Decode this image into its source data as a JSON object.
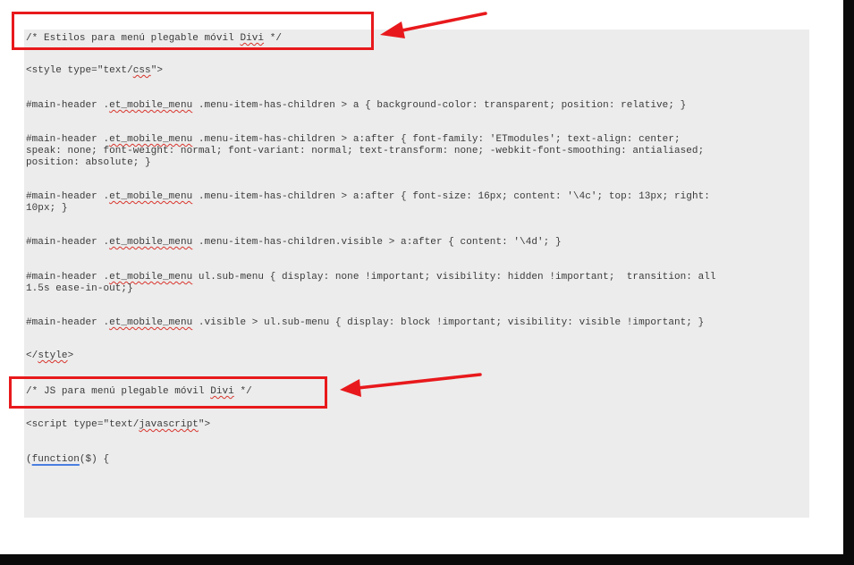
{
  "annotations": {
    "box_color": "#e8191c",
    "arrow_icon": "red-arrow-icon"
  },
  "code": {
    "comment_css": "/* Estilos para menú plegable móvil Divi */",
    "style_open": "<style type=\"text/css\">",
    "rule1": "#main-header .et_mobile_menu .menu-item-has-children > a { background-color: transparent; position: relative; }",
    "rule2_l1": "#main-header .et_mobile_menu .menu-item-has-children > a:after { font-family: 'ETmodules'; text-align: center;",
    "rule2_l2": "speak: none; font-weight: normal; font-variant: normal; text-transform: none; -webkit-font-smoothing: antialiased;",
    "rule2_l3": "position: absolute; }",
    "rule3_l1": "#main-header .et_mobile_menu .menu-item-has-children > a:after { font-size: 16px; content: '\\4c'; top: 13px; right:",
    "rule3_l2": "10px; }",
    "rule4": "#main-header .et_mobile_menu .menu-item-has-children.visible > a:after { content: '\\4d'; }",
    "rule5_l1": "#main-header .et_mobile_menu ul.sub-menu { display: none !important; visibility: hidden !important;  transition: all",
    "rule5_l2": "1.5s ease-in-out;}",
    "rule6": "#main-header .et_mobile_menu .visible > ul.sub-menu { display: block !important; visibility: visible !important; }",
    "style_close": "</style>",
    "comment_js": "/* JS para menú plegable móvil Divi */",
    "script_open": "<script type=\"text/javascript\">",
    "function_open": "(function($) {"
  }
}
